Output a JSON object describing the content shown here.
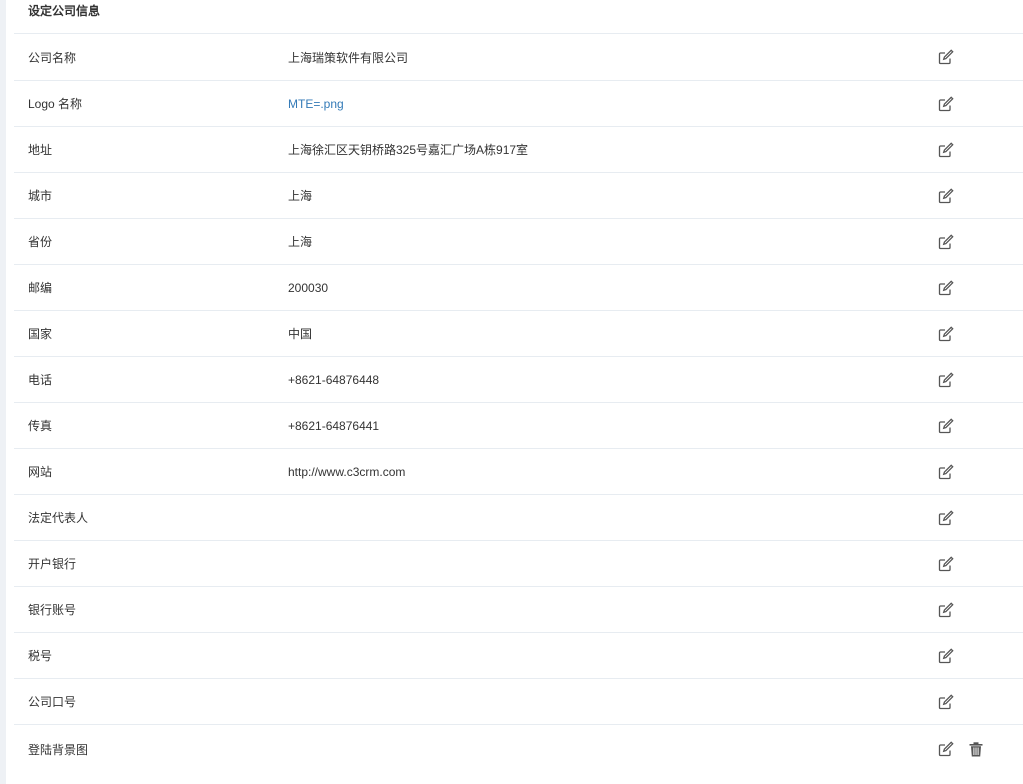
{
  "header": {
    "title": "设定公司信息"
  },
  "rows": [
    {
      "label": "公司名称",
      "value": ""
    },
    {
      "label": "Logo 名称",
      "value": "MTE=.png"
    },
    {
      "label": "地址",
      "value": "上海徐汇区天钥桥路325号嘉汇广场A栋917室"
    },
    {
      "label": "城市",
      "value": "上海"
    },
    {
      "label": "省份",
      "value": "上海"
    },
    {
      "label": "邮编",
      "value": "200030"
    },
    {
      "label": "国家",
      "value": "中国"
    },
    {
      "label": "电话",
      "value": "+8621-64876448"
    },
    {
      "label": "传真",
      "value": "+8621-64876441"
    },
    {
      "label": "网站",
      "value": "http://www.c3crm.com"
    },
    {
      "label": "法定代表人",
      "value": ""
    },
    {
      "label": "开户银行",
      "value": ""
    },
    {
      "label": "银行账号",
      "value": ""
    },
    {
      "label": "税号",
      "value": ""
    },
    {
      "label": "公司口号",
      "value": ""
    },
    {
      "label": "登陆背景图",
      "value": ""
    }
  ],
  "company_name_value": "上海瑞策软件有限公司",
  "colors": {
    "link": "#337ab7",
    "border": "#e7ecf1",
    "icon": "#555555"
  },
  "icons": {
    "edit": "edit-icon",
    "delete": "trash-icon"
  }
}
